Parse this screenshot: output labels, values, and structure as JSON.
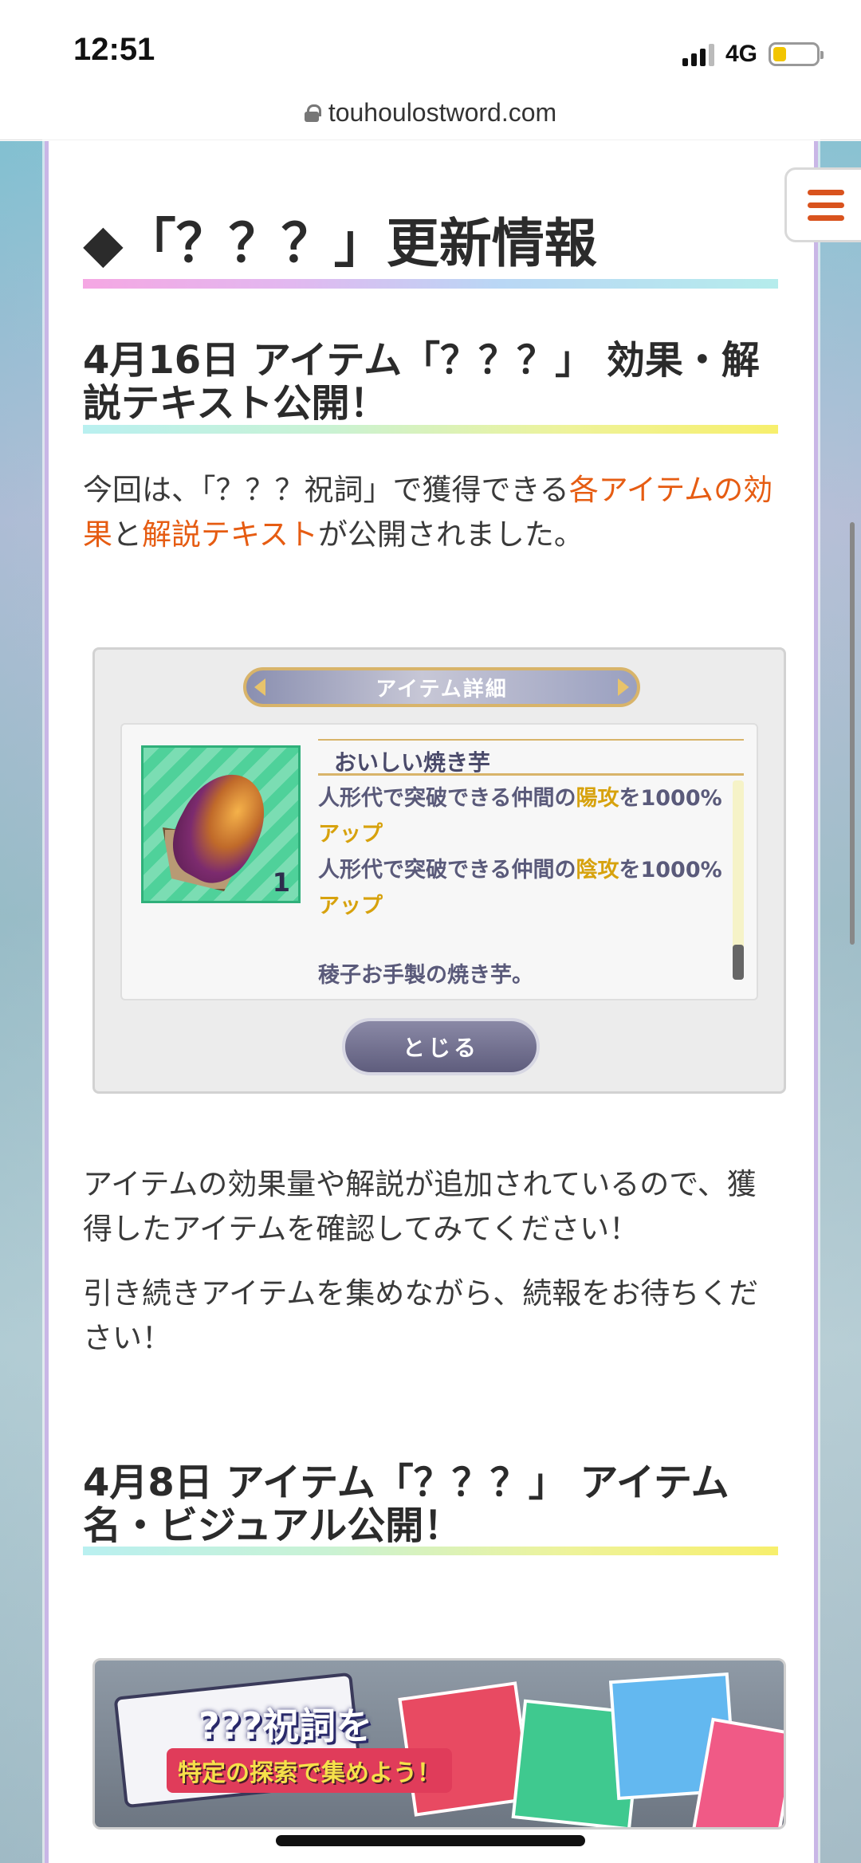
{
  "status_bar": {
    "time": "12:51",
    "network": "4G",
    "battery_level": 0.3,
    "battery_color": "#f2c500"
  },
  "browser": {
    "url": "touhoulostword.com",
    "icon": "lock-icon"
  },
  "page": {
    "menu_icon": "hamburger-menu-icon",
    "accent_color": "#e65c12",
    "section_title": "◆「？？？」更新情報",
    "update1": {
      "heading": "4月16日 アイテム「？？？」 効果・解説テキスト公開！",
      "intro_prefix": "今回は、「？？？祝詞」で獲得できる",
      "intro_link1": "各アイテムの効果",
      "intro_mid": "と",
      "intro_link2": "解説テキスト",
      "intro_suffix": "が公開されました。",
      "paragraph2": "アイテムの効果量や解説が追加されているので、獲得したアイテムを確認してみてください！",
      "paragraph3": "引き続きアイテムを集めながら、続報をお待ちください！"
    },
    "item_dialog": {
      "banner_label": "アイテム詳細",
      "item_name": "おいしい焼き芋",
      "item_count": "1",
      "effect1_prefix": "人形代で突破できる仲間の",
      "effect1_highlight": "陽攻",
      "effect1_suffix": "を1000%",
      "effect1_tail": "アップ",
      "effect2_prefix": "人形代で突破できる仲間の",
      "effect2_highlight": "陰攻",
      "effect2_suffix": "を1000%",
      "effect2_tail": "アップ",
      "flavor_text": "稜子お手製の焼き芋。",
      "close_label": "とじる"
    },
    "update2": {
      "heading": "4月8日 アイテム「？？？」 アイテム名・ビジュアル公開！"
    },
    "promo_banner": {
      "title": "???祝詞を",
      "subtitle": "特定の探索で集めよう！"
    }
  }
}
